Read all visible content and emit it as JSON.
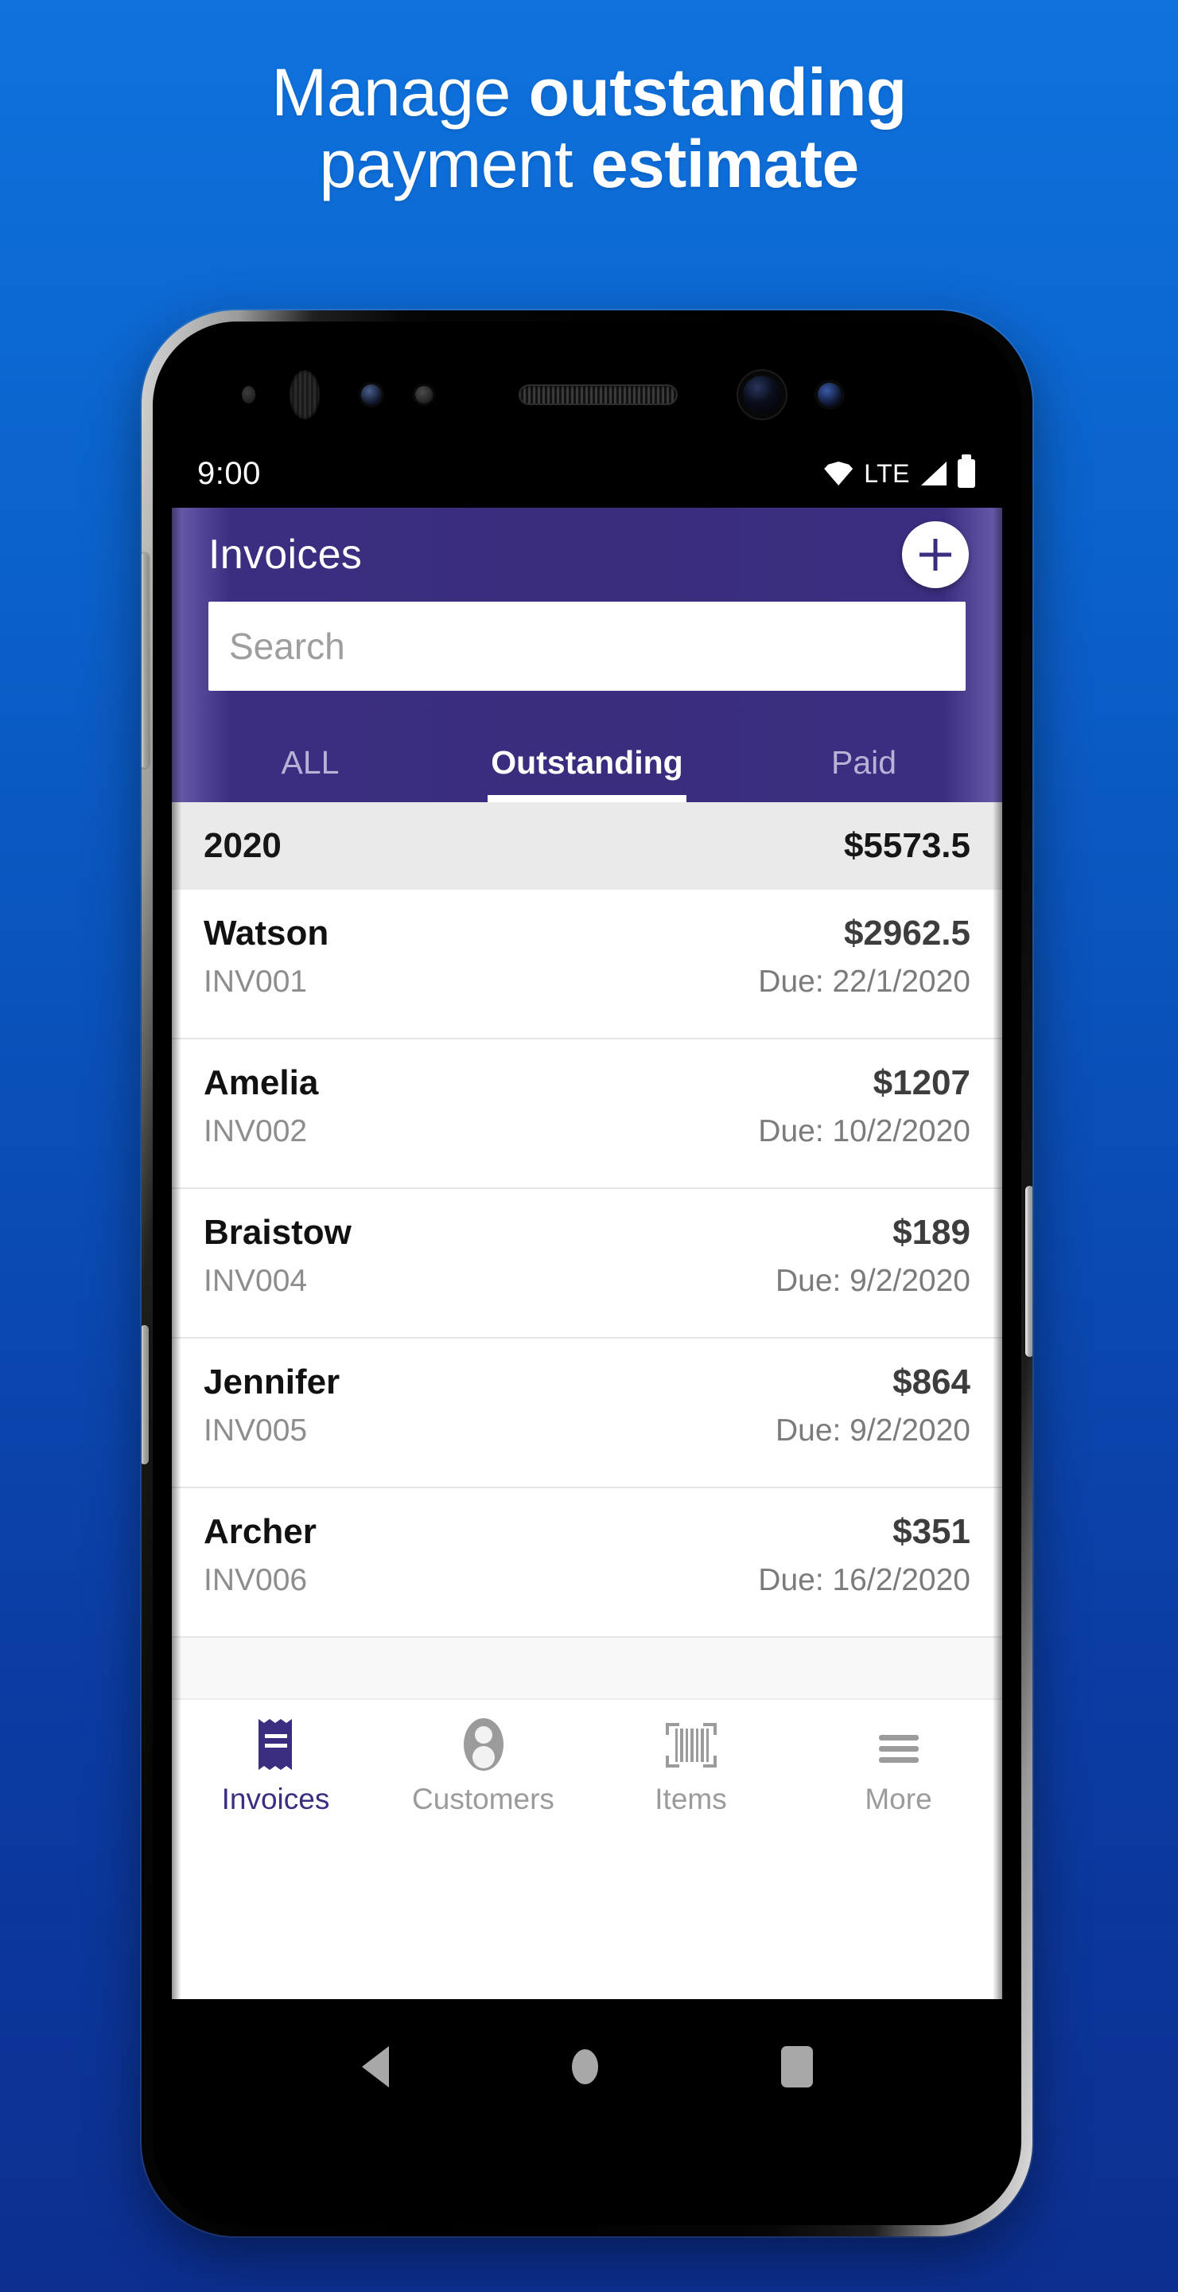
{
  "promo": {
    "line1_plain": "Manage ",
    "line1_bold": "outstanding",
    "line2_plain": "payment ",
    "line2_bold": "estimate",
    "background_color": "#0b63cd"
  },
  "status_bar": {
    "time": "9:00",
    "network_label": "LTE",
    "icons": [
      "wifi-icon",
      "signal-icon",
      "battery-icon"
    ]
  },
  "app_bar": {
    "title": "Invoices",
    "add_button_label": "+",
    "background_color": "#3b2e80"
  },
  "search": {
    "placeholder": "Search",
    "value": ""
  },
  "tabs": [
    {
      "label": "ALL",
      "active": false
    },
    {
      "label": "Outstanding",
      "active": true
    },
    {
      "label": "Paid",
      "active": false
    }
  ],
  "group_header": {
    "year": "2020",
    "total": "$5573.5"
  },
  "invoices": [
    {
      "customer": "Watson",
      "amount": "$2962.5",
      "number": "INV001",
      "due": "Due: 22/1/2020"
    },
    {
      "customer": "Amelia",
      "amount": "$1207",
      "number": "INV002",
      "due": "Due: 10/2/2020"
    },
    {
      "customer": "Braistow",
      "amount": "$189",
      "number": "INV004",
      "due": "Due: 9/2/2020"
    },
    {
      "customer": "Jennifer",
      "amount": "$864",
      "number": "INV005",
      "due": "Due: 9/2/2020"
    },
    {
      "customer": "Archer",
      "amount": "$351",
      "number": "INV006",
      "due": "Due: 16/2/2020"
    }
  ],
  "bottom_nav": [
    {
      "label": "Invoices",
      "icon": "receipt-icon",
      "active": true
    },
    {
      "label": "Customers",
      "icon": "person-icon",
      "active": false
    },
    {
      "label": "Items",
      "icon": "barcode-icon",
      "active": false
    },
    {
      "label": "More",
      "icon": "hamburger-icon",
      "active": false
    }
  ],
  "android_nav": {
    "back": "back-button",
    "home": "home-button",
    "recents": "recents-button"
  }
}
